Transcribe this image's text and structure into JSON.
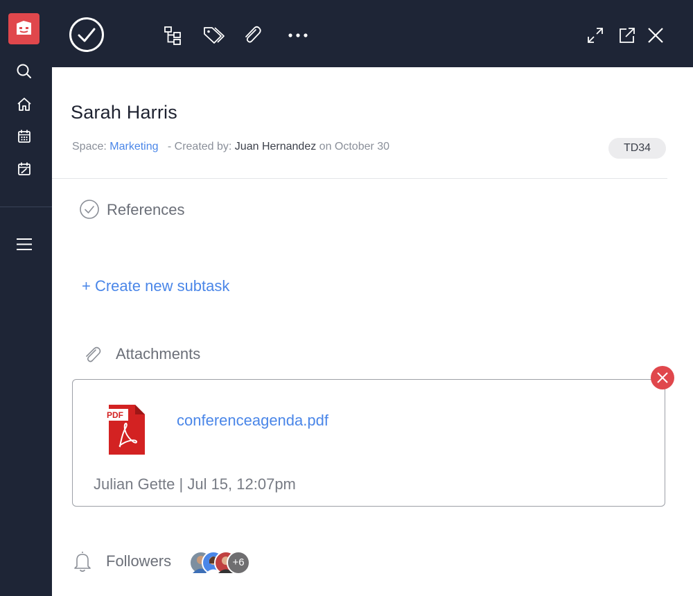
{
  "sidebar": {
    "items": [
      {
        "name": "search",
        "icon": "search-icon"
      },
      {
        "name": "home",
        "icon": "home-icon"
      },
      {
        "name": "calendar",
        "icon": "calendar-icon"
      },
      {
        "name": "calendar-edit",
        "icon": "calendar-edit-icon"
      },
      {
        "name": "menu",
        "icon": "hamburger-menu-icon"
      }
    ]
  },
  "toolbar": {
    "icons": [
      "check-circle-icon",
      "subtask-tree-icon",
      "tag-icon",
      "paperclip-icon",
      "more-icon",
      "expand-icon",
      "open-external-icon",
      "close-icon"
    ]
  },
  "task": {
    "title": "Sarah Harris",
    "space_label": "Space:",
    "space_name": "Marketing",
    "created_by_label": "- Created by:",
    "creator": "Juan Hernandez",
    "on_label": "on October 30",
    "id": "TD34"
  },
  "references": {
    "label": "References"
  },
  "subtask": {
    "create_label": "+ Create new subtask"
  },
  "attachments": {
    "label": "Attachments",
    "file": {
      "name": "conferenceagenda.pdf",
      "type_label": "PDF",
      "uploader_info": "Julian Gette | Jul 15, 12:07pm"
    }
  },
  "followers": {
    "label": "Followers",
    "extra_count": "+6"
  },
  "colors": {
    "dark_bg": "#1e2536",
    "brand_red": "#e0474c",
    "link_blue": "#4a86e8"
  }
}
